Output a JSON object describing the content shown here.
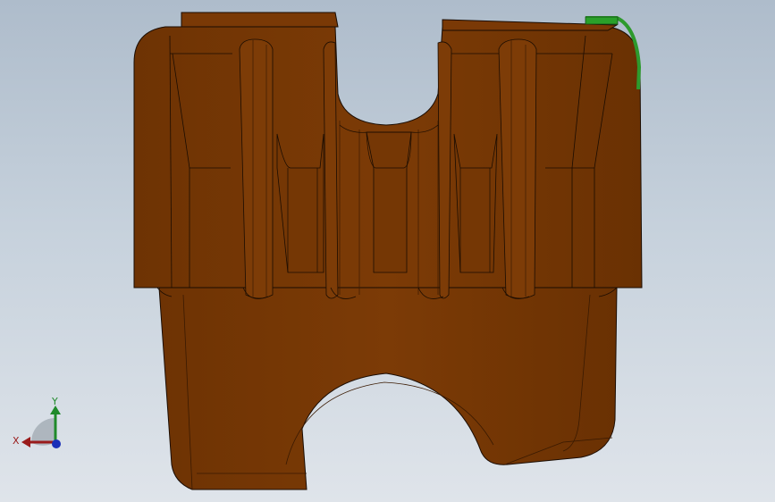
{
  "view": {
    "triad": {
      "x_label": "X",
      "y_label": "Y",
      "x_color": "#9a1b1b",
      "y_color": "#1f8a2a",
      "z_color": "#1b2fb8"
    },
    "model_colors": {
      "body": "#7a3a06",
      "edge": "#1a0c02",
      "highlight": "#2d9a2d"
    }
  }
}
